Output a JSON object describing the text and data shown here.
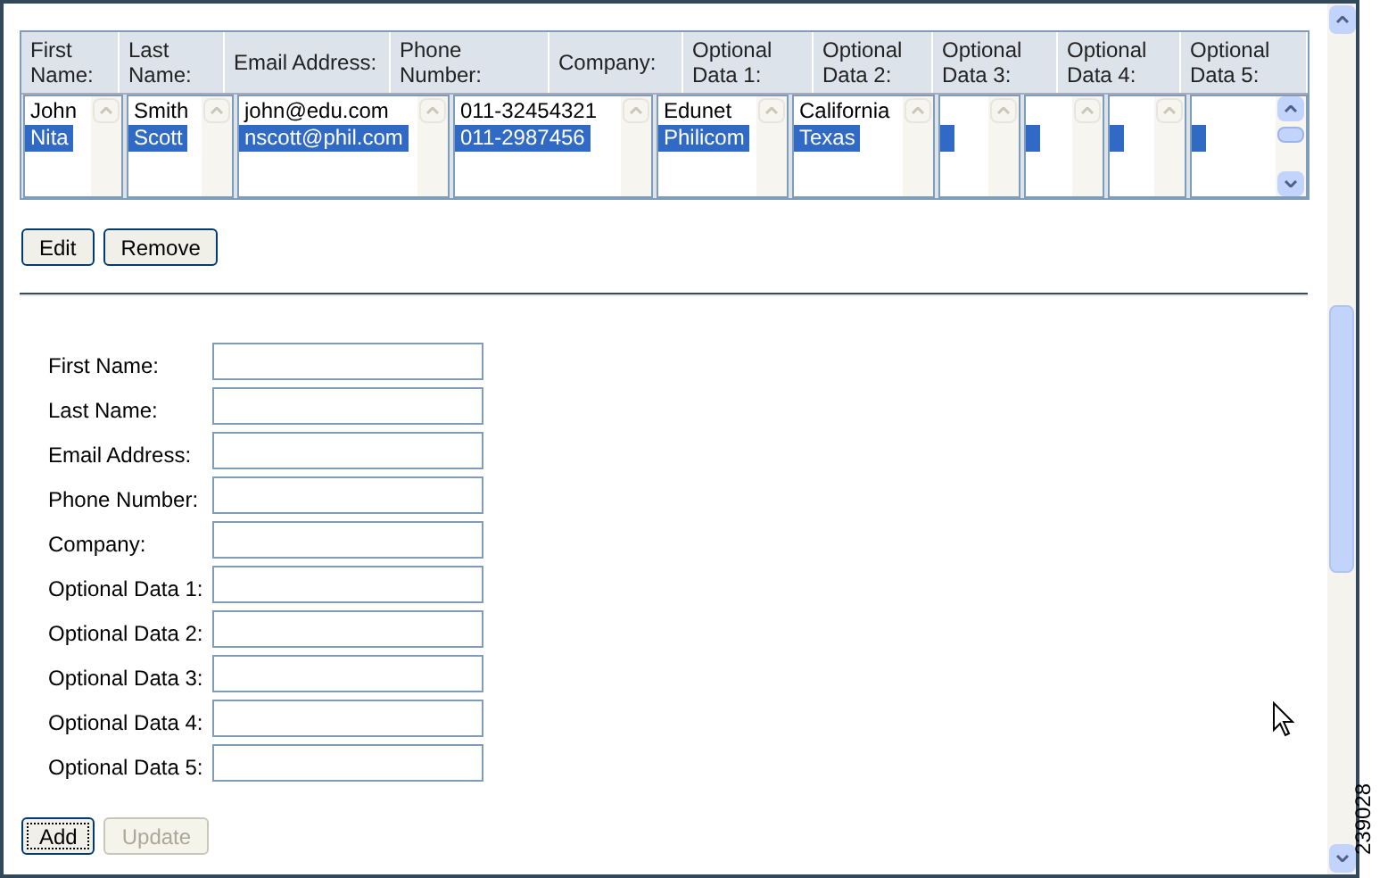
{
  "table": {
    "columns": [
      "First Name:",
      "Last Name:",
      "Email Address:",
      "Phone Number:",
      "Company:",
      "Optional Data 1:",
      "Optional Data 2:",
      "Optional Data 3:",
      "Optional Data 4:",
      "Optional Data 5:"
    ],
    "lists": [
      {
        "items": [
          {
            "text": "John",
            "selected": false
          },
          {
            "text": "Nita",
            "selected": true
          }
        ]
      },
      {
        "items": [
          {
            "text": "Smith",
            "selected": false
          },
          {
            "text": "Scott",
            "selected": true
          }
        ]
      },
      {
        "items": [
          {
            "text": "john@edu.com",
            "selected": false
          },
          {
            "text": "nscott@phil.com",
            "selected": true
          }
        ]
      },
      {
        "items": [
          {
            "text": "011-32454321",
            "selected": false
          },
          {
            "text": "011-2987456",
            "selected": true
          }
        ]
      },
      {
        "items": [
          {
            "text": "Edunet",
            "selected": false
          },
          {
            "text": "Philicom",
            "selected": true
          }
        ]
      },
      {
        "items": [
          {
            "text": "California",
            "selected": false
          },
          {
            "text": "Texas",
            "selected": true
          }
        ]
      },
      {
        "items": [
          {
            "selected": false
          },
          {
            "selected": true
          }
        ]
      },
      {
        "items": [
          {
            "selected": false
          },
          {
            "selected": true
          }
        ]
      },
      {
        "items": [
          {
            "selected": false
          },
          {
            "selected": true
          }
        ]
      },
      {
        "items": [
          {
            "selected": false
          },
          {
            "selected": true
          }
        ]
      }
    ]
  },
  "list_buttons": [
    {
      "label": "Edit",
      "disabled": false
    },
    {
      "label": "Remove",
      "disabled": false
    }
  ],
  "form": {
    "fields": [
      {
        "label": "First Name:"
      },
      {
        "label": "Last Name:"
      },
      {
        "label": "Email Address:"
      },
      {
        "label": "Phone Number:"
      },
      {
        "label": "Company:"
      },
      {
        "label": "Optional Data 1:"
      },
      {
        "label": "Optional Data 2:"
      },
      {
        "label": "Optional Data 3:"
      },
      {
        "label": "Optional Data 4:"
      },
      {
        "label": "Optional Data 5:"
      }
    ]
  },
  "form_buttons": [
    {
      "label": "Add",
      "disabled": false,
      "focused": true
    },
    {
      "label": "Update",
      "disabled": true,
      "focused": false
    }
  ],
  "figure_number": "239028"
}
